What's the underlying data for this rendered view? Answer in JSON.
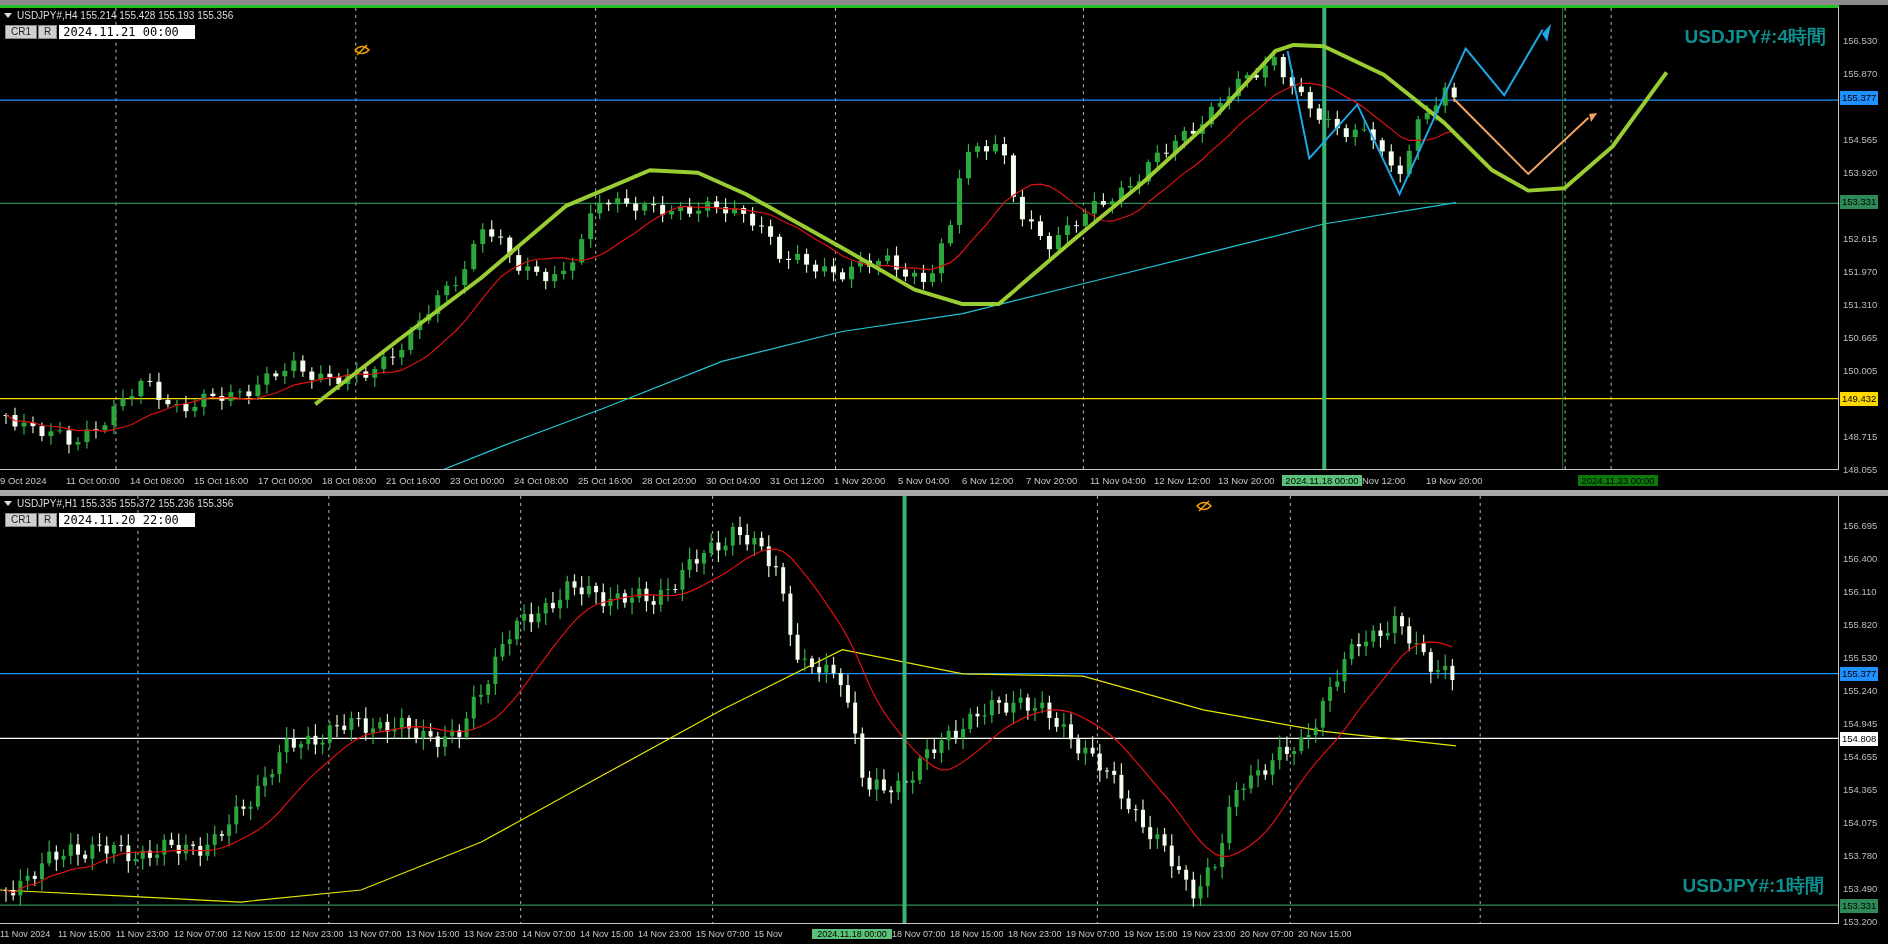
{
  "panels": [
    {
      "active": true,
      "header": "USDJPY#,H4 155.214 155.428 155.193 155.356",
      "buttons": [
        "CR1",
        "R"
      ],
      "date_field": "2024.11.21 00:00",
      "title": "USDJPY#:4時間",
      "price_ticks": [
        "156.530",
        "155.870",
        "154.565",
        "153.920",
        "152.615",
        "151.970",
        "151.310",
        "150.665",
        "150.005",
        "148.715",
        "148.055"
      ],
      "price_markers": [
        {
          "label": "155.377",
          "color": "#1e90ff"
        },
        {
          "label": "153.331",
          "color": "#2e8b57"
        },
        {
          "label": "149.432",
          "color": "#ffd700"
        }
      ],
      "time_labels": [
        {
          "label": "9 Oct 2024",
          "kind": "tick"
        },
        {
          "label": "11 Oct 00:00",
          "kind": "tick"
        },
        {
          "label": "14 Oct 08:00",
          "kind": "tick"
        },
        {
          "label": "15 Oct 16:00",
          "kind": "tick"
        },
        {
          "label": "17 Oct 00:00",
          "kind": "tick"
        },
        {
          "label": "18 Oct 08:00",
          "kind": "tick"
        },
        {
          "label": "21 Oct 16:00",
          "kind": "tick"
        },
        {
          "label": "23 Oct 00:00",
          "kind": "tick"
        },
        {
          "label": "24 Oct 08:00",
          "kind": "tick"
        },
        {
          "label": "25 Oct 16:00",
          "kind": "tick"
        },
        {
          "label": "28 Oct 20:00",
          "kind": "tick"
        },
        {
          "label": "30 Oct 04:00",
          "kind": "tick"
        },
        {
          "label": "31 Oct 12:00",
          "kind": "tick"
        },
        {
          "label": "1 Nov 20:00",
          "kind": "tick"
        },
        {
          "label": "5 Nov 04:00",
          "kind": "tick"
        },
        {
          "label": "6 Nov 12:00",
          "kind": "tick"
        },
        {
          "label": "7 Nov 20:00",
          "kind": "tick"
        },
        {
          "label": "11 Nov 04:00",
          "kind": "tick"
        },
        {
          "label": "12 Nov 12:00",
          "kind": "tick"
        },
        {
          "label": "13 Nov 20:00",
          "kind": "tick"
        },
        {
          "label": "2024.11.18 00:00",
          "kind": "highlight",
          "color": "#5cc27a"
        },
        {
          "label": "Nov 12:00",
          "kind": "tick"
        },
        {
          "label": "19 Nov 20:00",
          "kind": "tick"
        },
        {
          "label": "2024.11.23 00:00",
          "kind": "highlight",
          "color": "#0b7a0b"
        }
      ]
    },
    {
      "active": false,
      "header": "USDJPY#,H1 155.335 155.372 155.236 155.356",
      "buttons": [
        "CR1",
        "R"
      ],
      "date_field": "2024.11.20 22:00",
      "title": "USDJPY#:1時間",
      "price_ticks": [
        "156.695",
        "156.400",
        "156.110",
        "155.820",
        "155.530",
        "155.240",
        "154.945",
        "154.655",
        "154.365",
        "154.075",
        "153.780",
        "153.490",
        "153.200"
      ],
      "price_markers": [
        {
          "label": "155.377",
          "color": "#1e90ff"
        },
        {
          "label": "154.808",
          "color": "#ffffff"
        },
        {
          "label": "153.331",
          "color": "#2e8b57"
        }
      ],
      "time_labels": [
        {
          "label": "11 Nov 2024",
          "kind": "tick"
        },
        {
          "label": "11 Nov 15:00",
          "kind": "tick"
        },
        {
          "label": "11 Nov 23:00",
          "kind": "tick"
        },
        {
          "label": "12 Nov 07:00",
          "kind": "tick"
        },
        {
          "label": "12 Nov 15:00",
          "kind": "tick"
        },
        {
          "label": "12 Nov 23:00",
          "kind": "tick"
        },
        {
          "label": "13 Nov 07:00",
          "kind": "tick"
        },
        {
          "label": "13 Nov 15:00",
          "kind": "tick"
        },
        {
          "label": "13 Nov 23:00",
          "kind": "tick"
        },
        {
          "label": "14 Nov 07:00",
          "kind": "tick"
        },
        {
          "label": "14 Nov 15:00",
          "kind": "tick"
        },
        {
          "label": "14 Nov 23:00",
          "kind": "tick"
        },
        {
          "label": "15 Nov 07:00",
          "kind": "tick"
        },
        {
          "label": "15 Nov",
          "kind": "tick"
        },
        {
          "label": "2024.11.18 00:00",
          "kind": "highlight",
          "color": "#5cc27a"
        },
        {
          "label": "18 Nov 07:00",
          "kind": "tick"
        },
        {
          "label": "18 Nov 15:00",
          "kind": "tick"
        },
        {
          "label": "18 Nov 23:00",
          "kind": "tick"
        },
        {
          "label": "19 Nov 07:00",
          "kind": "tick"
        },
        {
          "label": "19 Nov 15:00",
          "kind": "tick"
        },
        {
          "label": "19 Nov 23:00",
          "kind": "tick"
        },
        {
          "label": "20 Nov 07:00",
          "kind": "tick"
        },
        {
          "label": "20 Nov 15:00",
          "kind": "tick"
        }
      ]
    }
  ]
}
